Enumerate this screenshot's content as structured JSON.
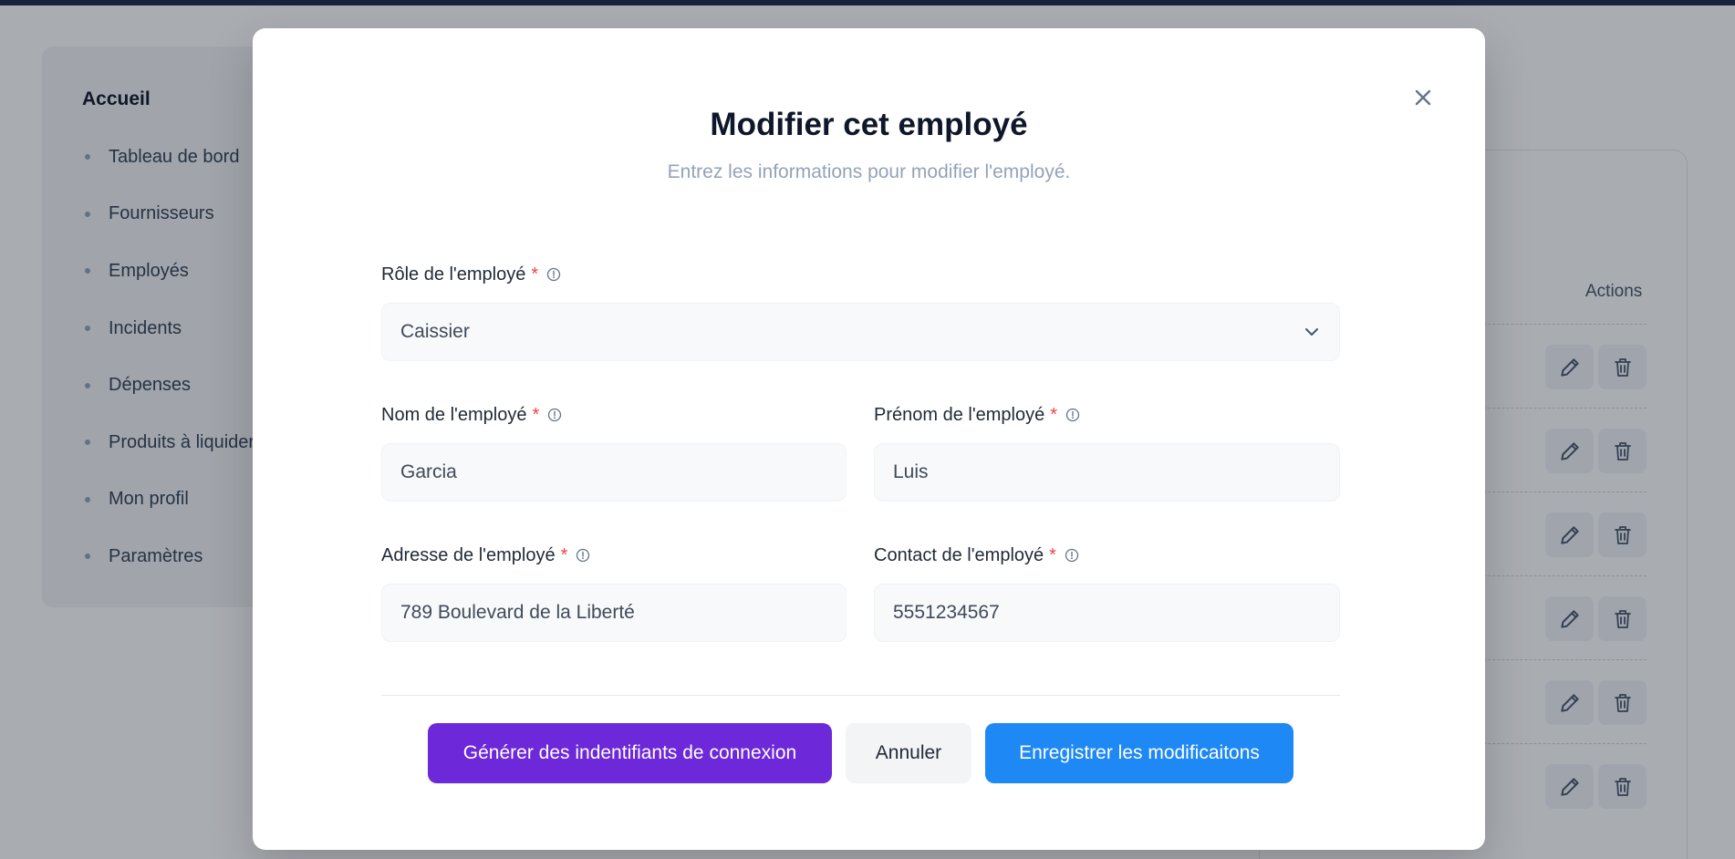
{
  "sidebar": {
    "title": "Accueil",
    "items": [
      {
        "label": "Tableau de bord"
      },
      {
        "label": "Fournisseurs"
      },
      {
        "label": "Employés"
      },
      {
        "label": "Incidents"
      },
      {
        "label": "Dépenses"
      },
      {
        "label": "Produits à liquider"
      },
      {
        "label": "Mon profil"
      },
      {
        "label": "Paramètres"
      }
    ]
  },
  "table": {
    "actions_header": "Actions",
    "row_count": 6
  },
  "modal": {
    "title": "Modifier cet employé",
    "subtitle": "Entrez les informations pour modifier l'employé.",
    "fields": {
      "role": {
        "label": "Rôle de l'employé",
        "value": "Caissier"
      },
      "last_name": {
        "label": "Nom de l'employé",
        "value": "Garcia"
      },
      "first_name": {
        "label": "Prénom de l'employé",
        "value": "Luis"
      },
      "address": {
        "label": "Adresse de l'employé",
        "value": "789 Boulevard de la Liberté"
      },
      "contact": {
        "label": "Contact de l'employé",
        "value": "5551234567"
      }
    },
    "required_marker": "*",
    "buttons": {
      "generate": "Générer des indentifiants de connexion",
      "cancel": "Annuler",
      "save": "Enregistrer les modificaitons"
    }
  },
  "colors": {
    "primary_purple": "#6d28d9",
    "primary_blue": "#1e88f5",
    "required_red": "#ef4444"
  }
}
